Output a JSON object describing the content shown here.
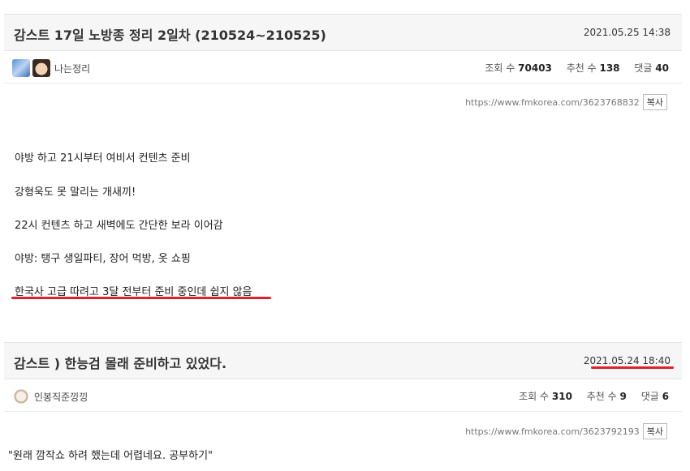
{
  "post1": {
    "title": "감스트 17일 노방종 정리 2일차 (210524~210525)",
    "date": "2021.05.25 14:38",
    "author": "나는정리",
    "views_label": "조회 수",
    "views": "70403",
    "recommends_label": "추천 수",
    "recommends": "138",
    "comments_label": "댓글",
    "comments": "40",
    "url": "https://www.fmkorea.com/3623768832",
    "copy_label": "복사",
    "lines": [
      "야방 하고 21시부터 여비서 컨텐츠 준비",
      "강형욱도 못 말리는 개새끼!",
      "22시 컨텐츠 하고 새벽에도 간단한 보라 이어감",
      "야방: 탱구 생일파티, 장어 먹방, 옷 쇼핑",
      "한국사 고급 따려고 3달 전부터 준비 중인데 쉽지 않음"
    ]
  },
  "post2": {
    "title": "감스트 ) 한능검 몰래 준비하고 있었다.",
    "date": "2021.05.24 18:40",
    "author": "인봉직준낑낑",
    "views_label": "조회 수",
    "views": "310",
    "recommends_label": "추천 수",
    "recommends": "9",
    "comments_label": "댓글",
    "comments": "6",
    "url": "https://www.fmkorea.com/3623792193",
    "copy_label": "복사",
    "lines": [
      "\"원래 깜작쇼 하려 했는데 어렵네요. 공부하기\""
    ]
  },
  "icons": {
    "avatar1a": "anime-avatar-icon",
    "avatar1b": "face-avatar-icon",
    "avatar2": "puppy-avatar-icon"
  },
  "colors": {
    "highlight_underline": "#e0202a",
    "header_bg": "#f6f6f6"
  }
}
